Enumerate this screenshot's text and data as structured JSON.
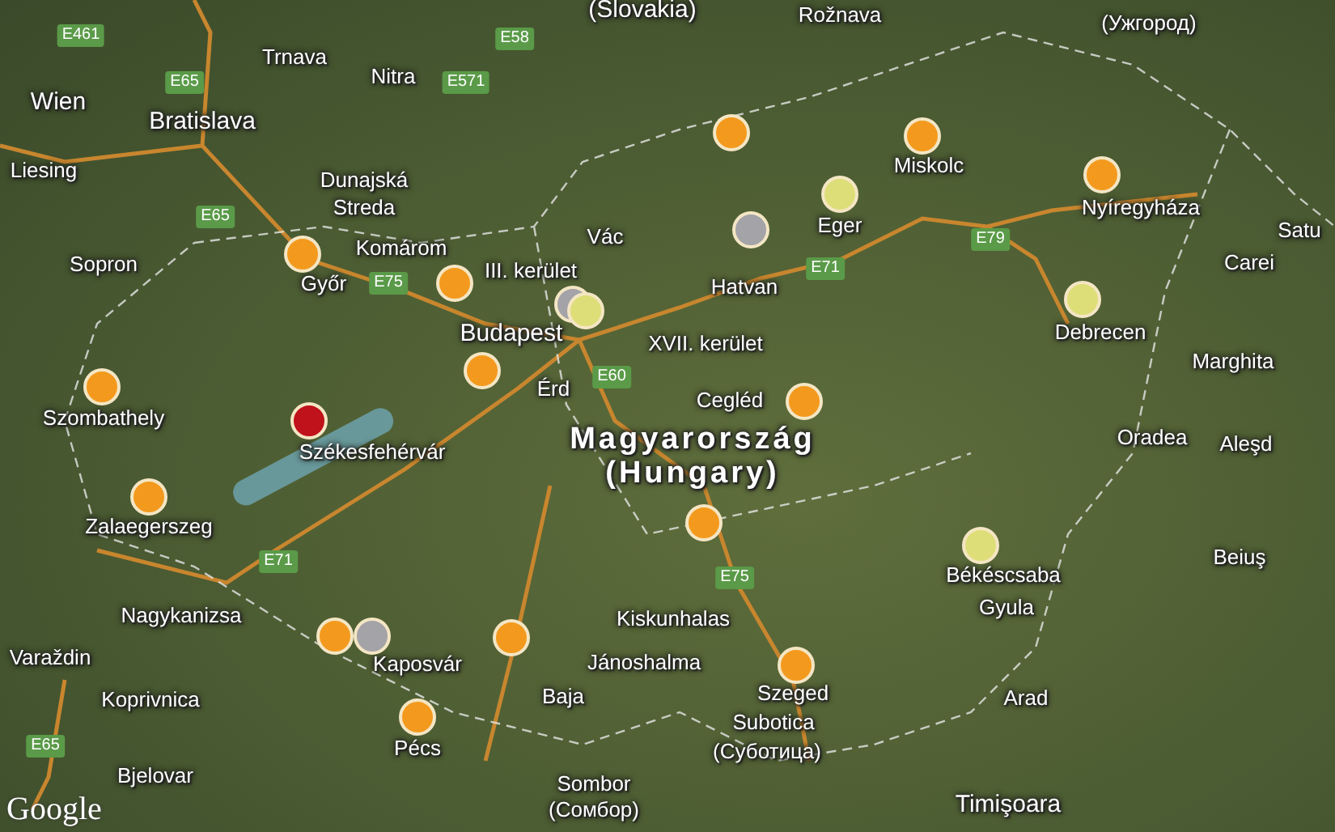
{
  "map": {
    "labels": [
      {
        "text": "(Slovakia)",
        "kind": "major"
      },
      {
        "text": "Rožnava",
        "kind": "minor"
      },
      {
        "text": "(Ужгород)",
        "kind": "minor"
      },
      {
        "text": "Trnava",
        "kind": "minor"
      },
      {
        "text": "Nitra",
        "kind": "minor"
      },
      {
        "text": "Wien",
        "kind": "major"
      },
      {
        "text": "Bratislava",
        "kind": "major"
      },
      {
        "text": "Miskolc",
        "kind": "minor"
      },
      {
        "text": "Liesing",
        "kind": "minor"
      },
      {
        "text": "Dunajská",
        "kind": "minor"
      },
      {
        "text": "Streda",
        "kind": "minor"
      },
      {
        "text": "Nyíregyháza",
        "kind": "minor"
      },
      {
        "text": "Eger",
        "kind": "minor"
      },
      {
        "text": "Vác",
        "kind": "minor"
      },
      {
        "text": "Satu",
        "kind": "minor"
      },
      {
        "text": "Komárom",
        "kind": "minor"
      },
      {
        "text": "Sopron",
        "kind": "minor"
      },
      {
        "text": "Győr",
        "kind": "minor"
      },
      {
        "text": "Carei",
        "kind": "minor"
      },
      {
        "text": "Hatvan",
        "kind": "minor"
      },
      {
        "text": "III. kerület",
        "kind": "minor"
      },
      {
        "text": "Debrecen",
        "kind": "minor"
      },
      {
        "text": "Budapest",
        "kind": "major"
      },
      {
        "text": "XVII. kerület",
        "kind": "minor"
      },
      {
        "text": "Marghita",
        "kind": "minor"
      },
      {
        "text": "Szombathely",
        "kind": "minor"
      },
      {
        "text": "Érd",
        "kind": "minor"
      },
      {
        "text": "Cegléd",
        "kind": "minor"
      },
      {
        "text": "Székesfehérvár",
        "kind": "minor"
      },
      {
        "text": "Magyarország",
        "kind": "country"
      },
      {
        "text": "Oradea",
        "kind": "minor"
      },
      {
        "text": "Aleşd",
        "kind": "minor"
      },
      {
        "text": "(Hungary)",
        "kind": "country"
      },
      {
        "text": "Zalaegerszeg",
        "kind": "minor"
      },
      {
        "text": "Békéscsaba",
        "kind": "minor"
      },
      {
        "text": "Beiuş",
        "kind": "minor"
      },
      {
        "text": "Gyula",
        "kind": "minor"
      },
      {
        "text": "Nagykanizsa",
        "kind": "minor"
      },
      {
        "text": "Kiskunhalas",
        "kind": "minor"
      },
      {
        "text": "Varaždin",
        "kind": "minor"
      },
      {
        "text": "Kaposvár",
        "kind": "minor"
      },
      {
        "text": "Jánoshalma",
        "kind": "minor"
      },
      {
        "text": "Koprivnica",
        "kind": "minor"
      },
      {
        "text": "Baja",
        "kind": "minor"
      },
      {
        "text": "Szeged",
        "kind": "minor"
      },
      {
        "text": "Arad",
        "kind": "minor"
      },
      {
        "text": "Pécs",
        "kind": "minor"
      },
      {
        "text": "Subotica",
        "kind": "minor"
      },
      {
        "text": "(Суботица)",
        "kind": "minor"
      },
      {
        "text": "Bjelovar",
        "kind": "minor"
      },
      {
        "text": "Sombor",
        "kind": "minor"
      },
      {
        "text": "(Сомбор)",
        "kind": "minor"
      },
      {
        "text": "Timişoara",
        "kind": "major"
      }
    ],
    "road_shields": [
      "E461",
      "E58",
      "E65",
      "E571",
      "E65",
      "E79",
      "E75",
      "E71",
      "E60",
      "E71",
      "E75",
      "E65"
    ],
    "markers": [
      {
        "color": "#f39a1e"
      },
      {
        "color": "#f39a1e"
      },
      {
        "color": "#f39a1e"
      },
      {
        "color": "#dede78"
      },
      {
        "color": "#a3a3a8"
      },
      {
        "color": "#f39a1e"
      },
      {
        "color": "#f39a1e"
      },
      {
        "color": "#a3a3a8"
      },
      {
        "color": "#dede78"
      },
      {
        "color": "#dede78"
      },
      {
        "color": "#f39a1e"
      },
      {
        "color": "#f39a1e"
      },
      {
        "color": "#c0121a"
      },
      {
        "color": "#f39a1e"
      },
      {
        "color": "#f39a1e"
      },
      {
        "color": "#f39a1e"
      },
      {
        "color": "#dede78"
      },
      {
        "color": "#f39a1e"
      },
      {
        "color": "#a3a3a8"
      },
      {
        "color": "#f39a1e"
      },
      {
        "color": "#f39a1e"
      },
      {
        "color": "#f39a1e"
      }
    ],
    "logo": "Google"
  }
}
